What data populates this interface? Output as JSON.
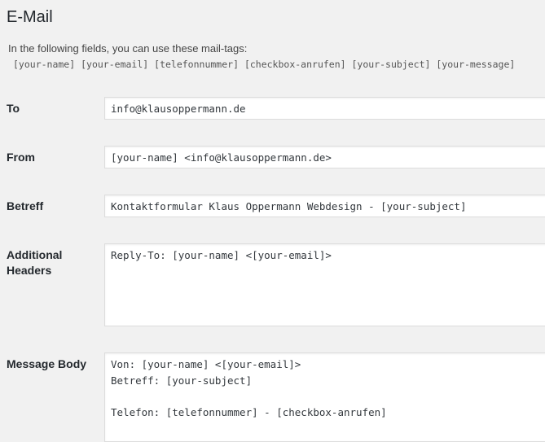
{
  "section": {
    "title": "E-Mail",
    "intro": "In the following fields, you can use these mail-tags:",
    "mail_tags": [
      "[your-name]",
      "[your-email]",
      "[telefonnummer]",
      "[checkbox-anrufen]",
      "[your-subject]",
      "[your-message]"
    ]
  },
  "fields": {
    "to": {
      "label": "To",
      "value": "info@klausoppermann.de"
    },
    "from": {
      "label": "From",
      "value": "[your-name] <info@klausoppermann.de>"
    },
    "subject": {
      "label": "Betreff",
      "value": "Kontaktformular Klaus Oppermann Webdesign - [your-subject]"
    },
    "additional_headers": {
      "label_line1": "Additional",
      "label_line2": "Headers",
      "value": "Reply-To: [your-name] <[your-email]>"
    },
    "message_body": {
      "label": "Message Body",
      "value": "Von: [your-name] <[your-email]>\nBetreff: [your-subject]\n\nTelefon: [telefonnummer] - [checkbox-anrufen]"
    }
  }
}
